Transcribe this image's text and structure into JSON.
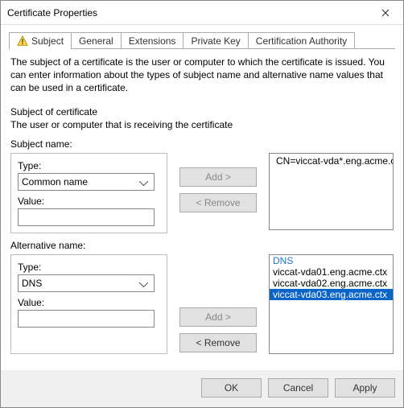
{
  "window": {
    "title": "Certificate Properties"
  },
  "tabs": {
    "items": [
      {
        "label": "Subject"
      },
      {
        "label": "General"
      },
      {
        "label": "Extensions"
      },
      {
        "label": "Private Key"
      },
      {
        "label": "Certification Authority"
      }
    ]
  },
  "panel": {
    "description": "The subject of a certificate is the user or computer to which the certificate is issued. You can enter information about the types of subject name and alternative name values that can be used in a certificate.",
    "subject_heading": "Subject of certificate",
    "subject_sub": "The user or computer that is receiving the certificate",
    "subject_name_label": "Subject name:",
    "alt_name_label": "Alternative name:",
    "type_label": "Type:",
    "value_label": "Value:",
    "add_label": "Add >",
    "remove_label": "< Remove",
    "subject_type_options": [
      "Common name"
    ],
    "subject_type_selected": "Common name",
    "subject_value": "",
    "alt_type_options": [
      "DNS"
    ],
    "alt_type_selected": "DNS",
    "alt_value": "",
    "subject_list": [
      "CN=viccat-vda*.eng.acme.ctx"
    ],
    "alt_list_heading": "DNS",
    "alt_list": [
      {
        "text": "viccat-vda01.eng.acme.ctx",
        "selected": false
      },
      {
        "text": "viccat-vda02.eng.acme.ctx",
        "selected": false
      },
      {
        "text": "viccat-vda03.eng.acme.ctx",
        "selected": true
      }
    ]
  },
  "footer": {
    "ok": "OK",
    "cancel": "Cancel",
    "apply": "Apply"
  }
}
